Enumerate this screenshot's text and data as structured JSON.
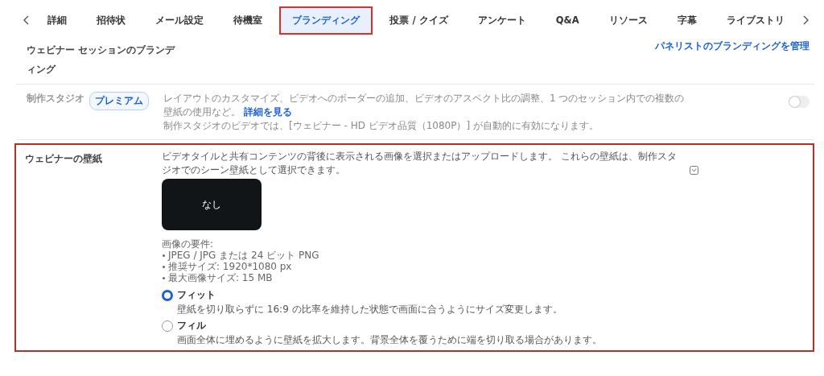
{
  "tabs": [
    {
      "label": "詳細",
      "selected": false,
      "highlighted": false
    },
    {
      "label": "招待状",
      "selected": false,
      "highlighted": false
    },
    {
      "label": "メール設定",
      "selected": false,
      "highlighted": false
    },
    {
      "label": "待機室",
      "selected": false,
      "highlighted": false
    },
    {
      "label": "ブランディング",
      "selected": true,
      "highlighted": true
    },
    {
      "label": "投票 / クイズ",
      "selected": false,
      "highlighted": false
    },
    {
      "label": "アンケート",
      "selected": false,
      "highlighted": false
    },
    {
      "label": "Q&A",
      "selected": false,
      "highlighted": false
    },
    {
      "label": "リソース",
      "selected": false,
      "highlighted": false
    },
    {
      "label": "字幕",
      "selected": false,
      "highlighted": false
    },
    {
      "label": "ライブストリ",
      "selected": false,
      "highlighted": false
    }
  ],
  "header": {
    "title": "ウェビナー セッションのブランディング",
    "link": "パネリストのブランディングを管理"
  },
  "studio": {
    "label": "制作スタジオ",
    "badge": "プレミアム",
    "description": "レイアウトのカスタマイズ、ビデオへのボーダーの追加、ビデオのアスペクト比の調整、1 つのセッション内での複数の壁紙の使用など。",
    "link": "詳細を見る",
    "note": "制作スタジオのビデオでは、[ウェビナー - HD ビデオ品質（1080P）] が自動的に有効になります。",
    "on": false
  },
  "wallpaper": {
    "highlighted": true,
    "label": "ウェビナーの壁紙",
    "description": "ビデオタイルと共有コンテンツの背後に表示される画像を選択またはアップロードします。 これらの壁紙は、制作スタジオでのシーン壁紙として選択できます。",
    "preview": "なし",
    "requirements_title": "画像の要件:",
    "requirements": [
      "JPEG / JPG または 24 ビット PNG",
      "推奨サイズ: 1920*1080 px",
      "最大画像サイズ: 15 MB"
    ],
    "options": [
      {
        "title": "フィット",
        "description": "壁紙を切り取らずに 16:9 の比率を維持した状態で画面に合うようにサイズ変更します。",
        "selected": true
      },
      {
        "title": "フィル",
        "description": "画面全体に埋めるように壁紙を拡大します。背景全体を覆うために端を切り取る場合があります。",
        "selected": false
      }
    ]
  }
}
